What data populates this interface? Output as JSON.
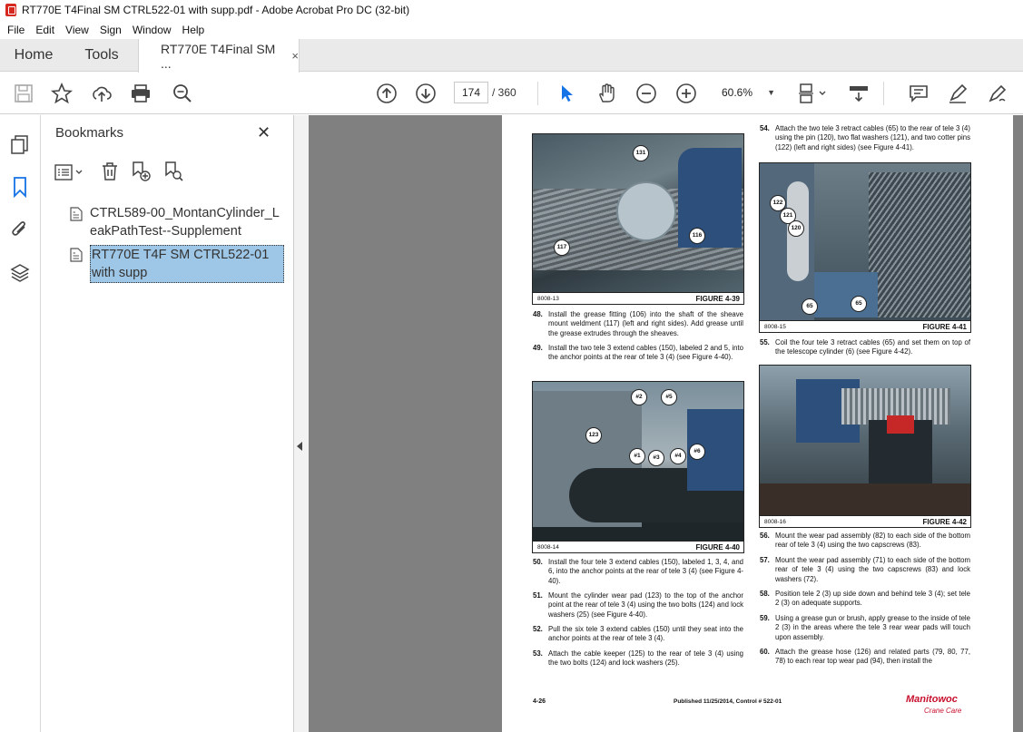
{
  "window": {
    "title": "RT770E T4Final SM CTRL522-01 with supp.pdf - Adobe Acrobat Pro DC (32-bit)"
  },
  "menu": [
    "File",
    "Edit",
    "View",
    "Sign",
    "Window",
    "Help"
  ],
  "tabs": {
    "home": "Home",
    "tools": "Tools",
    "document": "RT770E T4Final SM ...",
    "close": "×"
  },
  "toolbar": {
    "current_page": "174",
    "page_total": "/  360",
    "zoom": "60.6%"
  },
  "bookmarks": {
    "title": "Bookmarks",
    "close": "✕",
    "items": [
      {
        "label": "CTRL589-00_MontanCylinder_LeakPathTest--Supplement",
        "selected": false
      },
      {
        "label": "RT770E T4F SM CTRL522-01 with supp",
        "selected": true
      }
    ]
  },
  "document": {
    "figures": [
      {
        "number": "FIGURE 4-39",
        "code": "8008-13",
        "callouts": [
          "131",
          "117",
          "116"
        ]
      },
      {
        "number": "FIGURE 4-40",
        "code": "8008-14",
        "callouts": [
          "#2",
          "#5",
          "123",
          "#1",
          "#3",
          "#4",
          "#6"
        ]
      },
      {
        "number": "FIGURE 4-41",
        "code": "8008-15",
        "callouts": [
          "122",
          "121",
          "120",
          "65",
          "65"
        ]
      },
      {
        "number": "FIGURE 4-42",
        "code": "8008-16",
        "callouts": []
      }
    ],
    "steps": [
      {
        "num": "48.",
        "text": "Install the grease fitting (106) into the shaft of the sheave mount weldment (117) (left and right sides). Add grease until the grease extrudes through the sheaves."
      },
      {
        "num": "49.",
        "text": "Install the two tele 3 extend cables (150), labeled 2 and 5, into the anchor points at the rear of tele 3 (4) (see Figure 4-40)."
      },
      {
        "num": "50.",
        "text": "Install the four tele 3 extend cables (150), labeled 1, 3, 4, and 6, into the anchor points at the rear of tele 3 (4) (see Figure 4-40)."
      },
      {
        "num": "51.",
        "text": "Mount the cylinder wear pad (123) to the top of the anchor point at the rear of tele 3 (4) using the two bolts (124) and lock washers (25) (see Figure 4-40)."
      },
      {
        "num": "52.",
        "text": "Pull the six tele 3 extend cables (150) until they seat into the anchor points at the rear of tele 3 (4)."
      },
      {
        "num": "53.",
        "text": "Attach the cable keeper (125) to the rear of tele 3 (4) using the two bolts (124) and lock washers (25)."
      },
      {
        "num": "54.",
        "text": "Attach the two tele 3 retract cables (65) to the rear of tele 3 (4) using the pin (120), two flat washers (121), and two cotter pins (122) (left and right sides) (see Figure 4-41)."
      },
      {
        "num": "55.",
        "text": "Coil the four tele 3 retract cables (65) and set them on top of the telescope cylinder (6) (see Figure 4-42)."
      },
      {
        "num": "56.",
        "text": "Mount the wear pad assembly (82) to each side of the bottom rear of tele 3 (4) using the two capscrews (83)."
      },
      {
        "num": "57.",
        "text": "Mount the wear pad assembly (71) to each side of the bottom rear of tele 3 (4) using the two capscrews (83) and lock washers (72)."
      },
      {
        "num": "58.",
        "text": "Position tele 2 (3) up side down and behind tele 3 (4); set tele 2 (3) on adequate supports."
      },
      {
        "num": "59.",
        "text": "Using a grease gun or brush, apply grease to the inside of tele 2 (3) in the areas where the tele 3 rear wear pads will touch upon assembly."
      },
      {
        "num": "60.",
        "text": "Attach the grease hose (126) and related parts (79, 80, 77, 78) to each rear top wear pad (94), then install the"
      }
    ],
    "footer": {
      "page": "4-26",
      "published": "Published 11/25/2014, Control # 522-01",
      "logo": "Manitowoc",
      "logo_sub": "Crane Care"
    }
  }
}
